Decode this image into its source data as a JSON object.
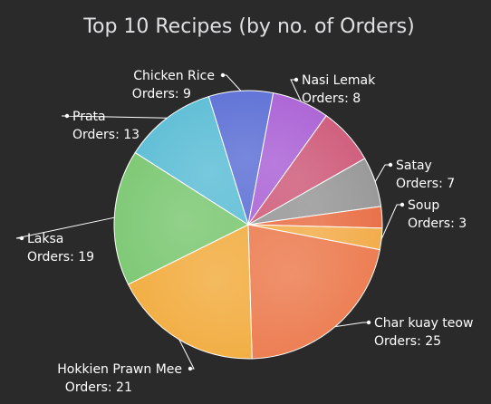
{
  "chart_data": {
    "type": "pie",
    "title": "Top 10 Recipes (by no. of Orders)",
    "value_prefix": "Orders: ",
    "slices": [
      {
        "name": "Chicken Rice",
        "value": 9,
        "color": "#4a5fd0"
      },
      {
        "name": "Nasi Lemak",
        "value": 8,
        "color": "#a04fd0"
      },
      {
        "name": "",
        "value": 8,
        "color": "#c8476a"
      },
      {
        "name": "Satay",
        "value": 7,
        "color": "#8a8a8a"
      },
      {
        "name": "",
        "value": 3,
        "color": "#e55b2c"
      },
      {
        "name": "Soup",
        "value": 3,
        "color": "#f0a030"
      },
      {
        "name": "Char kuay teow",
        "value": 25,
        "color": "#ea6c3b"
      },
      {
        "name": "Hokkien Prawn Mee",
        "value": 21,
        "color": "#f0a32a"
      },
      {
        "name": "Laksa",
        "value": 19,
        "color": "#6cc162"
      },
      {
        "name": "Prata",
        "value": 13,
        "color": "#4ab6d0"
      }
    ]
  }
}
